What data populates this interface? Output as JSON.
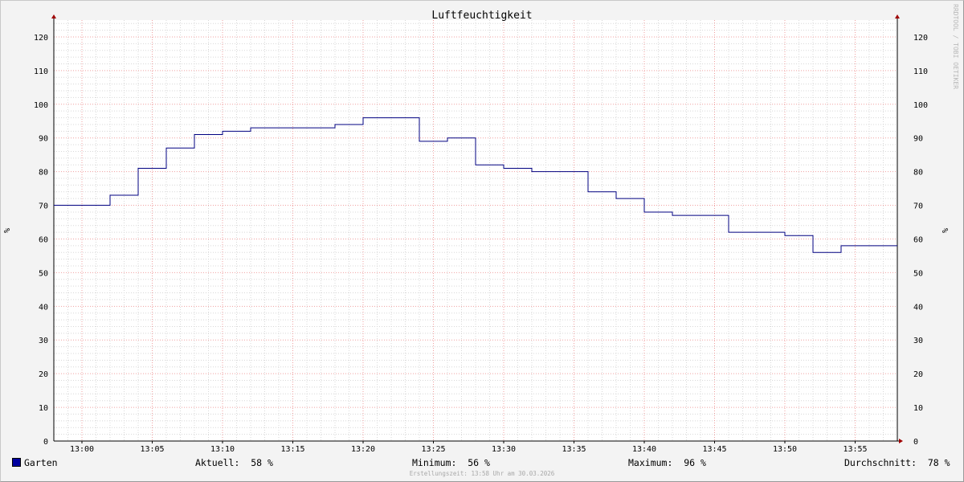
{
  "chart_data": {
    "type": "line",
    "title": "Luftfeuchtigkeit",
    "ylabel": "%",
    "ylim": [
      0,
      125
    ],
    "y_ticks": [
      0,
      10,
      20,
      30,
      40,
      50,
      60,
      70,
      80,
      90,
      100,
      110,
      120
    ],
    "x_tick_labels": [
      "13:00",
      "13:05",
      "13:10",
      "13:15",
      "13:20",
      "13:25",
      "13:30",
      "13:35",
      "13:40",
      "13:45",
      "13:50",
      "13:55"
    ],
    "xlim": [
      "12:58",
      "13:58"
    ],
    "grid": true,
    "step": true,
    "series": [
      {
        "name": "Garten",
        "color": "#000080",
        "x": [
          "12:58",
          "13:02",
          "13:04",
          "13:06",
          "13:08",
          "13:10",
          "13:12",
          "13:14",
          "13:16",
          "13:18",
          "13:20",
          "13:22",
          "13:24",
          "13:26",
          "13:28",
          "13:30",
          "13:32",
          "13:34",
          "13:36",
          "13:38",
          "13:40",
          "13:42",
          "13:44",
          "13:46",
          "13:48",
          "13:50",
          "13:52",
          "13:54",
          "13:56"
        ],
        "values": [
          70,
          73,
          81,
          87,
          91,
          92,
          93,
          93,
          93,
          94,
          96,
          96,
          89,
          90,
          82,
          81,
          80,
          80,
          74,
          72,
          68,
          67,
          67,
          62,
          62,
          61,
          56,
          58,
          58
        ]
      }
    ]
  },
  "legend": {
    "series_name": "Garten",
    "current": "Aktuell:  58 %",
    "minimum": "Minimum:  56 %",
    "maximum": "Maximum:  96 %",
    "average": "Durchschnitt:  78 %"
  },
  "watermark": "RRDTOOL / TOBI OETIKER",
  "footer": "Erstellungszeit: 13:58 Uhr am 30.03.2026",
  "colors": {
    "series": "#000080",
    "grid_major": "#f0a0a0",
    "grid_minor": "#d8d8d8",
    "background": "#ffffff",
    "axis_arrow": "#a00000"
  }
}
